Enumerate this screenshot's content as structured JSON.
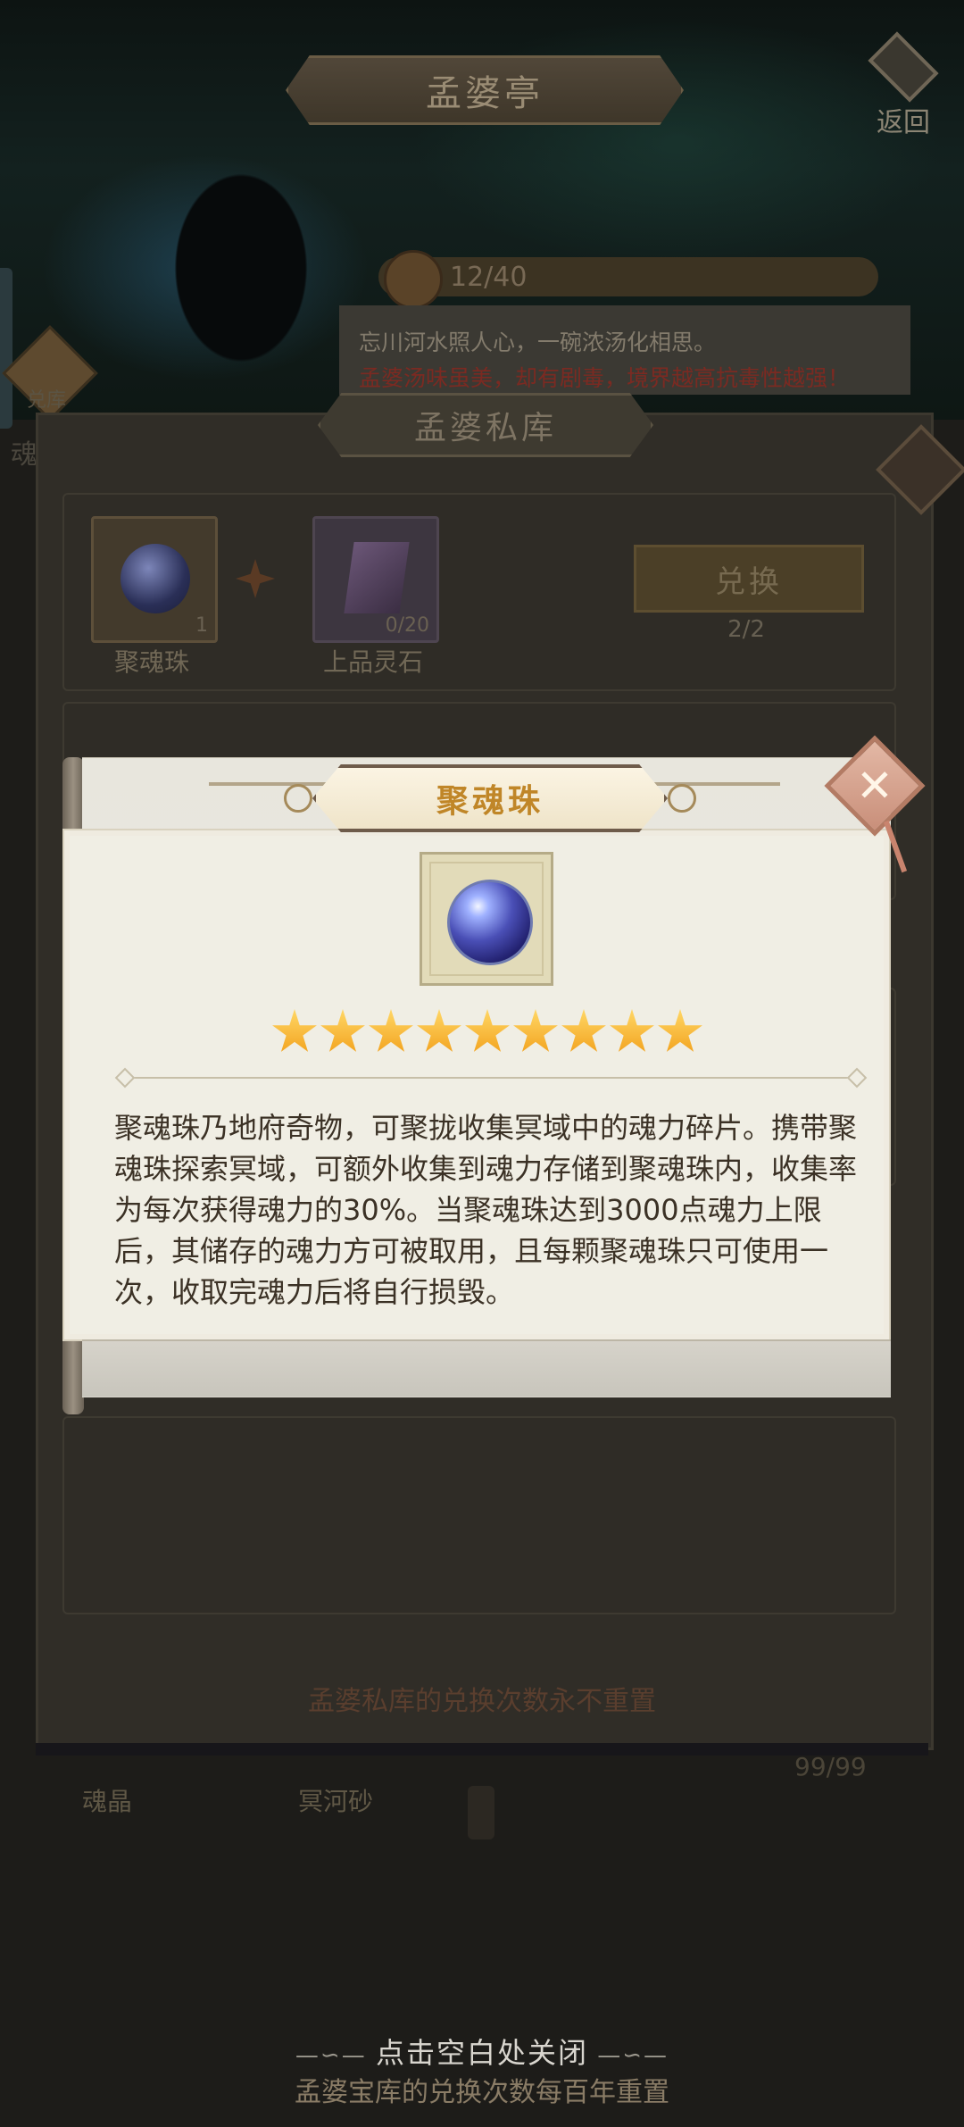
{
  "header": {
    "title": "孟婆亭",
    "back_label": "返回",
    "energy": "12/40",
    "info_line1": "忘川河水照人心，一碗浓汤化相思。",
    "info_line2": "孟婆汤味虽美，却有剧毒，境界越高抗毒性越强！",
    "left_badge": "兑库",
    "left_char": "魂"
  },
  "vault": {
    "title": "孟婆私库",
    "rows": [
      {
        "item_a_label": "聚魂珠",
        "item_a_count": "1",
        "item_b_label": "上品灵石",
        "item_b_count": "0/20",
        "button": "兑换",
        "remaining": "2/2"
      }
    ],
    "footer": "孟婆私库的兑换次数永不重置",
    "under_label_1": "魂晶",
    "under_label_2": "冥河砂",
    "under_count": "99/99"
  },
  "modal": {
    "title": "聚魂珠",
    "stars": 9,
    "description": "聚魂珠乃地府奇物，可聚拢收集冥域中的魂力碎片。携带聚魂珠探索冥域，可额外收集到魂力存储到聚魂珠内，收集率为每次获得魂力的30%。当聚魂珠达到3000点魂力上限后，其储存的魂力方可被取用，且每颗聚魂珠只可使用一次，收取完魂力后将自行损毁。"
  },
  "close_hint": "点击空白处关闭",
  "bottom_reset": "孟婆宝库的兑换次数每百年重置",
  "colors": {
    "title_gold": "#c08628",
    "star": "#f6b52a",
    "close_button": "#c98f7a"
  }
}
